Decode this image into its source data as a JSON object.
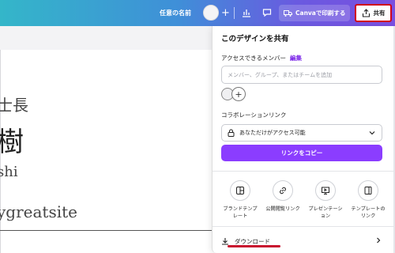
{
  "topbar": {
    "design_name": "任意の名前",
    "add_label": "+",
    "print_label": "Canvaで印刷する",
    "share_label": "共有"
  },
  "canvas": {
    "line1": "士長",
    "line2": "樹",
    "line3": "shi",
    "line4": "ygreatsite"
  },
  "share_panel": {
    "title": "このデザインを共有",
    "access_label": "アクセスできるメンバー",
    "edit_label": "編集",
    "input_placeholder": "メンバー、グループ、またはチームを追加",
    "add_label": "+",
    "collab_label": "コラボレーションリンク",
    "access_value": "あなただけがアクセス可能",
    "copy_button": "リンクをコピー",
    "options": [
      {
        "label": "ブランドテンプ\nレート",
        "icon": "brand-template-icon"
      },
      {
        "label": "公開閲覧リンク",
        "icon": "link-icon"
      },
      {
        "label": "プレゼンテーシ\nョン",
        "icon": "presentation-icon"
      },
      {
        "label": "テンプレートの\nリンク",
        "icon": "template-link-icon"
      }
    ],
    "download_label": "ダウンロード"
  },
  "colors": {
    "accent": "#8b3dff",
    "highlight": "#d0021b"
  }
}
